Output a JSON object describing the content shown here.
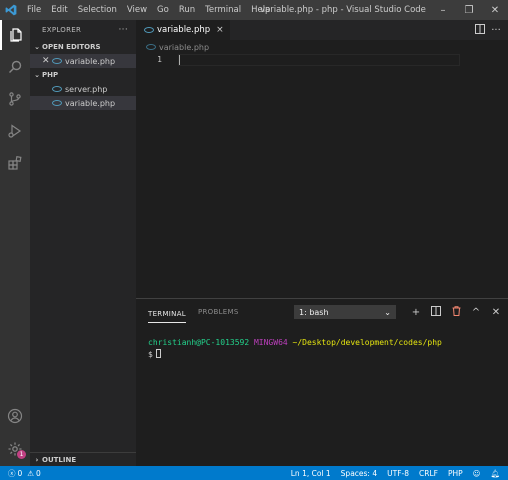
{
  "titlebar": {
    "menu": [
      "File",
      "Edit",
      "Selection",
      "View",
      "Go",
      "Run",
      "Terminal",
      "Help"
    ],
    "title": "variable.php - php - Visual Studio Code",
    "minimize": "–",
    "restore": "❐",
    "close": "✕"
  },
  "sidebar": {
    "title": "EXPLORER",
    "more": "···",
    "open_editors_label": "OPEN EDITORS",
    "open_editors": [
      {
        "name": "variable.php"
      }
    ],
    "folder_label": "PHP",
    "files": [
      {
        "name": "server.php"
      },
      {
        "name": "variable.php"
      }
    ],
    "outline_label": "OUTLINE"
  },
  "activitybar": {
    "settings_badge": "1"
  },
  "editor": {
    "tab": {
      "label": "variable.php",
      "close": "×"
    },
    "breadcrumb": "variable.php",
    "line_numbers": [
      "1"
    ]
  },
  "panel": {
    "tabs": [
      "TERMINAL",
      "PROBLEMS"
    ],
    "terminal_select": "1: bash",
    "terminal": {
      "user_host": "christianh@PC-1013592",
      "shell": "MINGW64",
      "path": "~/Desktop/development/codes/php",
      "prompt": "$"
    }
  },
  "statusbar": {
    "errors": "0",
    "warnings": "0",
    "position": "Ln 1, Col 1",
    "spaces": "Spaces: 4",
    "encoding": "UTF-8",
    "eol": "CRLF",
    "language": "PHP"
  },
  "colors": {
    "accent": "#007acc",
    "titlebar": "#3c3c3c",
    "activitybar": "#333333",
    "sidebar": "#252526",
    "editor": "#1e1e1e"
  }
}
